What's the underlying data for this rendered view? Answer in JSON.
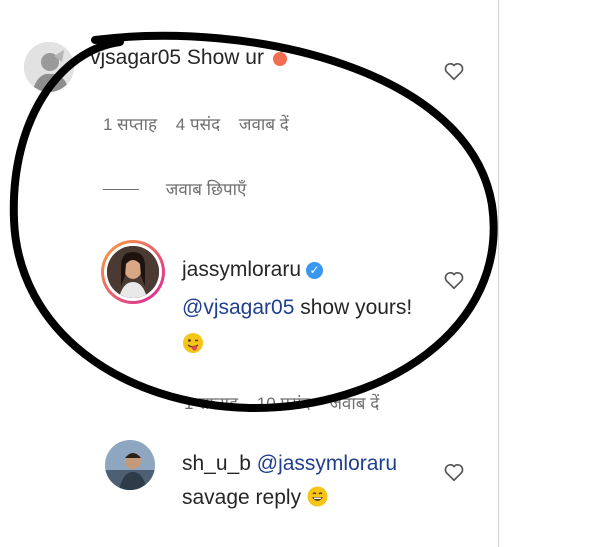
{
  "comment1": {
    "username": "vjsagar05",
    "text": "Show ur",
    "emoji_icon": "peach-emoji-icon",
    "time": "1 सप्ताह",
    "likes": "4 पसंद",
    "reply": "जवाब दें",
    "hide_replies": "जवाब छिपाएँ"
  },
  "reply1": {
    "username": "jassymloraru",
    "verified_icon": "verified-badge-icon",
    "mention": "@vjsagar05",
    "text": "show yours!",
    "emoji_icon": "winking-tongue-emoji-icon",
    "time": "1 सप्ताह",
    "likes": "10 पसंद",
    "reply": "जवाब दें"
  },
  "reply2": {
    "username": "sh_u_b",
    "mention": "@jassymloraru",
    "text": "savage reply",
    "emoji_icon": "grinning-emoji-icon"
  },
  "colors": {
    "meta_text": "#6f6f6f",
    "mention": "#1f3f8f",
    "verified_blue": "#3897f0",
    "story_ring_start": "#f9a23a",
    "story_ring_end": "#d6249f",
    "annotation_ellipse": "#000000"
  }
}
